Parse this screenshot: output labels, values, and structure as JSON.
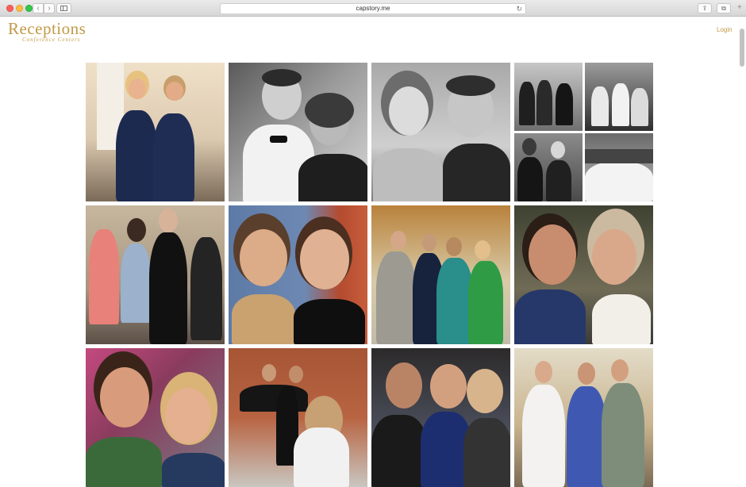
{
  "browser": {
    "url": "capstory.me",
    "nav_back": "‹",
    "nav_forward": "›",
    "reload_icon": "↻",
    "share_icon": "⇪",
    "tabs_icon": "⧉",
    "new_tab_icon": "+"
  },
  "header": {
    "logo_text": "Receptions",
    "logo_tagline": "Conference Centers",
    "login_label": "Login",
    "accent_color": "#c19a46"
  },
  "gallery": {
    "photos": [
      {
        "id": "bridesmaids-navy-dresses",
        "icon": "photo-icon"
      },
      {
        "id": "couple-selfie-bw",
        "icon": "photo-icon"
      },
      {
        "id": "couple-closeup-bw",
        "icon": "photo-icon"
      },
      {
        "id": "collage-four-bw",
        "icon": "photo-icon"
      },
      {
        "id": "party-dancing",
        "icon": "photo-icon"
      },
      {
        "id": "two-women-selfie",
        "icon": "photo-icon"
      },
      {
        "id": "group-four-formal",
        "icon": "photo-icon"
      },
      {
        "id": "couple-selfie-color",
        "icon": "photo-icon"
      },
      {
        "id": "couple-selfie-outdoor",
        "icon": "photo-icon"
      },
      {
        "id": "groom-carrying-bride",
        "icon": "photo-icon"
      },
      {
        "id": "family-three",
        "icon": "photo-icon"
      },
      {
        "id": "three-young-men",
        "icon": "photo-icon"
      }
    ]
  }
}
